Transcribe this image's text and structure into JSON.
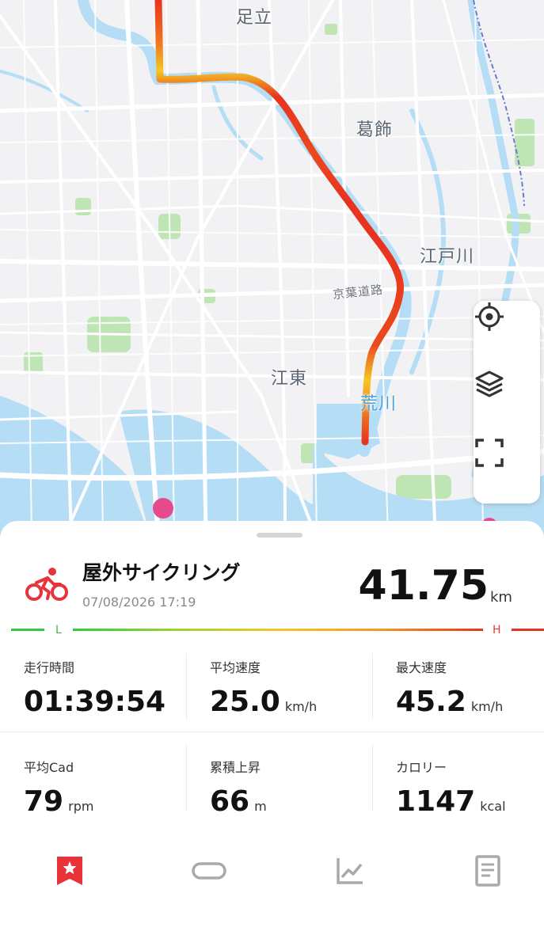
{
  "map": {
    "labels": {
      "adachi": "足立",
      "katsushika": "葛飾",
      "edogawa": "江戸川",
      "keiyo_road": "京葉道路",
      "koto": "江東",
      "arakawa": "荒川"
    }
  },
  "map_controls": {
    "locate_icon": "crosshair-icon",
    "layers_icon": "layers-icon",
    "fullscreen_icon": "fullscreen-icon"
  },
  "activity": {
    "icon": "bicycle-icon",
    "title": "屋外サイクリング",
    "datetime": "07/08/2026 17:19",
    "distance": "41.75",
    "distance_unit": "km"
  },
  "speed_legend": {
    "low": "L",
    "high": "H",
    "colors": [
      "#2ecc40",
      "#f6c625",
      "#e8331f"
    ]
  },
  "stats": [
    {
      "label": "走行時間",
      "value": "01:39:54",
      "unit": ""
    },
    {
      "label": "平均速度",
      "value": "25.0",
      "unit": "km/h"
    },
    {
      "label": "最大速度",
      "value": "45.2",
      "unit": "km/h"
    },
    {
      "label": "平均Cad",
      "value": "79",
      "unit": "rpm"
    },
    {
      "label": "累積上昇",
      "value": "66",
      "unit": "m"
    },
    {
      "label": "カロリー",
      "value": "1147",
      "unit": "kcal"
    }
  ],
  "tabs": [
    {
      "icon": "bookmark-star-icon",
      "active": true
    },
    {
      "icon": "link-icon",
      "active": false
    },
    {
      "icon": "chart-line-icon",
      "active": false
    },
    {
      "icon": "document-icon",
      "active": false
    }
  ],
  "colors": {
    "accent": "#e8333b",
    "water": "#b5ddf5",
    "park": "#b9e3b0",
    "route_high": "#e8331f",
    "route_mid": "#f6c625"
  }
}
